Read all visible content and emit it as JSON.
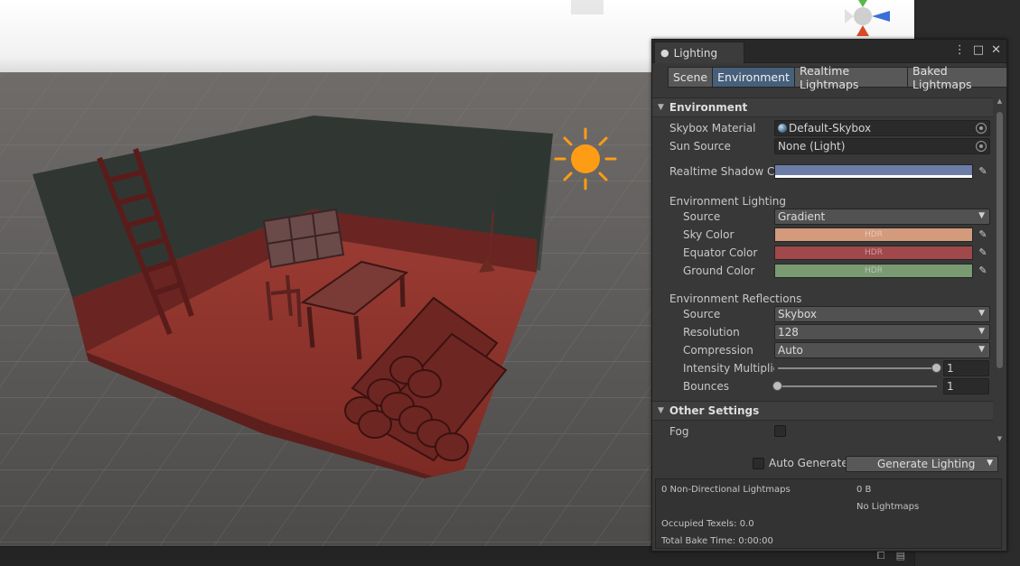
{
  "window": {
    "title": "Lighting",
    "tabs": [
      {
        "label": "Scene",
        "active": false
      },
      {
        "label": "Environment",
        "active": true
      },
      {
        "label": "Realtime Lightmaps",
        "active": false
      },
      {
        "label": "Baked Lightmaps",
        "active": false
      }
    ]
  },
  "environment": {
    "header": "Environment",
    "skybox_material_label": "Skybox Material",
    "skybox_material_value": "Default-Skybox",
    "sun_source_label": "Sun Source",
    "sun_source_value": "None (Light)",
    "realtime_shadow_label": "Realtime Shadow Color",
    "realtime_shadow_color": "#6b7ca6",
    "lighting": {
      "header": "Environment Lighting",
      "source_label": "Source",
      "source_value": "Gradient",
      "sky_label": "Sky Color",
      "sky_color": "#d39a7c",
      "equator_label": "Equator Color",
      "equator_color": "#a0484a",
      "ground_label": "Ground Color",
      "ground_color": "#7a9a72",
      "hdr_tag": "HDR"
    },
    "reflections": {
      "header": "Environment Reflections",
      "source_label": "Source",
      "source_value": "Skybox",
      "resolution_label": "Resolution",
      "resolution_value": "128",
      "compression_label": "Compression",
      "compression_value": "Auto",
      "intensity_label": "Intensity Multiplier",
      "intensity_value": "1",
      "intensity_fraction": 1.0,
      "bounces_label": "Bounces",
      "bounces_value": "1",
      "bounces_fraction": 0.0
    }
  },
  "other": {
    "header": "Other Settings",
    "fog_label": "Fog",
    "fog_checked": false
  },
  "footer": {
    "auto_generate_label": "Auto Generate",
    "auto_generate_checked": false,
    "generate_button": "Generate Lighting"
  },
  "stats": {
    "lightmaps": "0 Non-Directional Lightmaps",
    "size": "0 B",
    "no_lightmaps": "No Lightmaps",
    "occupied": "Occupied Texels: 0.0",
    "bake_time": "Total Bake Time: 0:00:00"
  },
  "icons": {
    "window_icon": "light-bulb-icon",
    "menu": "kebab-menu-icon",
    "maximize": "maximize-icon",
    "close": "close-icon"
  }
}
